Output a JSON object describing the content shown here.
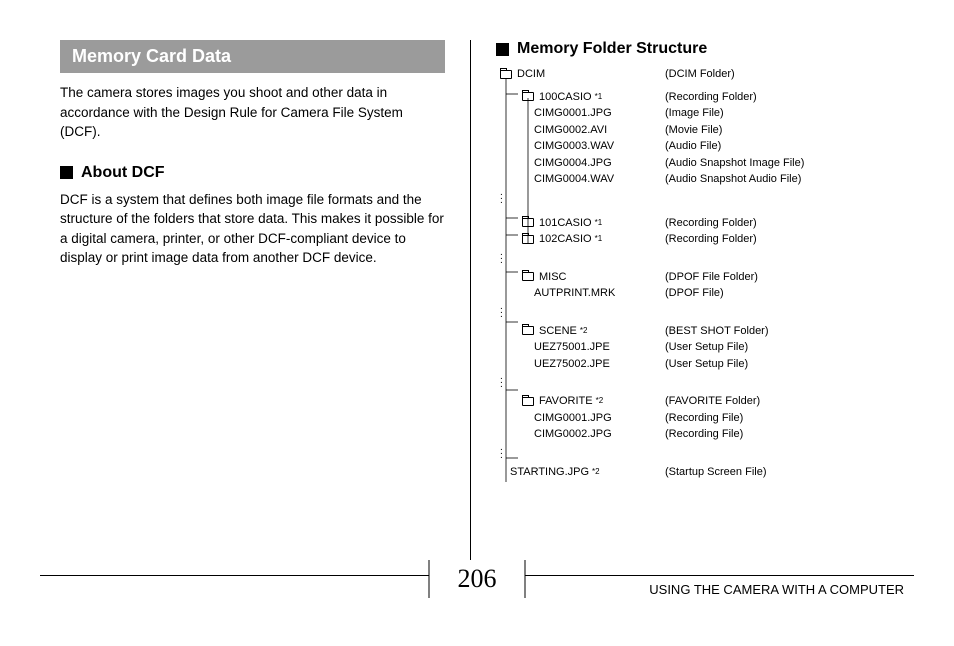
{
  "banner_title": "Memory Card Data",
  "intro_para": "The camera stores images you shoot and other data in accordance with the Design Rule for Camera File System (DCF).",
  "about_heading": "About DCF",
  "about_para": "DCF is a system that defines both image file formats and the structure of the folders that store data. This makes it possible for a digital camera, printer, or other DCF-compliant device to display or print image data from another DCF device.",
  "right_heading": "Memory Folder Structure",
  "tree": {
    "dcim": {
      "name": "DCIM",
      "desc": "(DCIM Folder)"
    },
    "f100casio": {
      "name": "100CASIO",
      "sup": "*1",
      "desc": "(Recording Folder)"
    },
    "cimg1": {
      "name": "CIMG0001.JPG",
      "desc": "(Image File)"
    },
    "cimg2": {
      "name": "CIMG0002.AVI",
      "desc": "(Movie File)"
    },
    "cimg3": {
      "name": "CIMG0003.WAV",
      "desc": "(Audio File)"
    },
    "cimg4": {
      "name": "CIMG0004.JPG",
      "desc": "(Audio Snapshot Image File)"
    },
    "cimg5": {
      "name": "CIMG0004.WAV",
      "desc": "(Audio Snapshot Audio File)"
    },
    "f101casio": {
      "name": "101CASIO",
      "sup": "*1",
      "desc": "(Recording Folder)"
    },
    "f102casio": {
      "name": "102CASIO",
      "sup": "*1",
      "desc": "(Recording Folder)"
    },
    "misc": {
      "name": "MISC",
      "desc": "(DPOF File Folder)"
    },
    "autprint": {
      "name": "AUTPRINT.MRK",
      "desc": "(DPOF File)"
    },
    "scene": {
      "name": "SCENE",
      "sup": "*2",
      "desc": "(BEST SHOT Folder)"
    },
    "uez1": {
      "name": "UEZ75001.JPE",
      "desc": "(User Setup File)"
    },
    "uez2": {
      "name": "UEZ75002.JPE",
      "desc": "(User Setup File)"
    },
    "favorite": {
      "name": "FAVORITE",
      "sup": "*2",
      "desc": "(FAVORITE Folder)"
    },
    "fav1": {
      "name": "CIMG0001.JPG",
      "desc": "(Recording File)"
    },
    "fav2": {
      "name": "CIMG0002.JPG",
      "desc": "(Recording File)"
    },
    "starting": {
      "name": "STARTING.JPG",
      "sup": "*2",
      "desc": "(Startup Screen File)"
    }
  },
  "page_number": "206",
  "footer_text": "USING THE CAMERA WITH A COMPUTER"
}
